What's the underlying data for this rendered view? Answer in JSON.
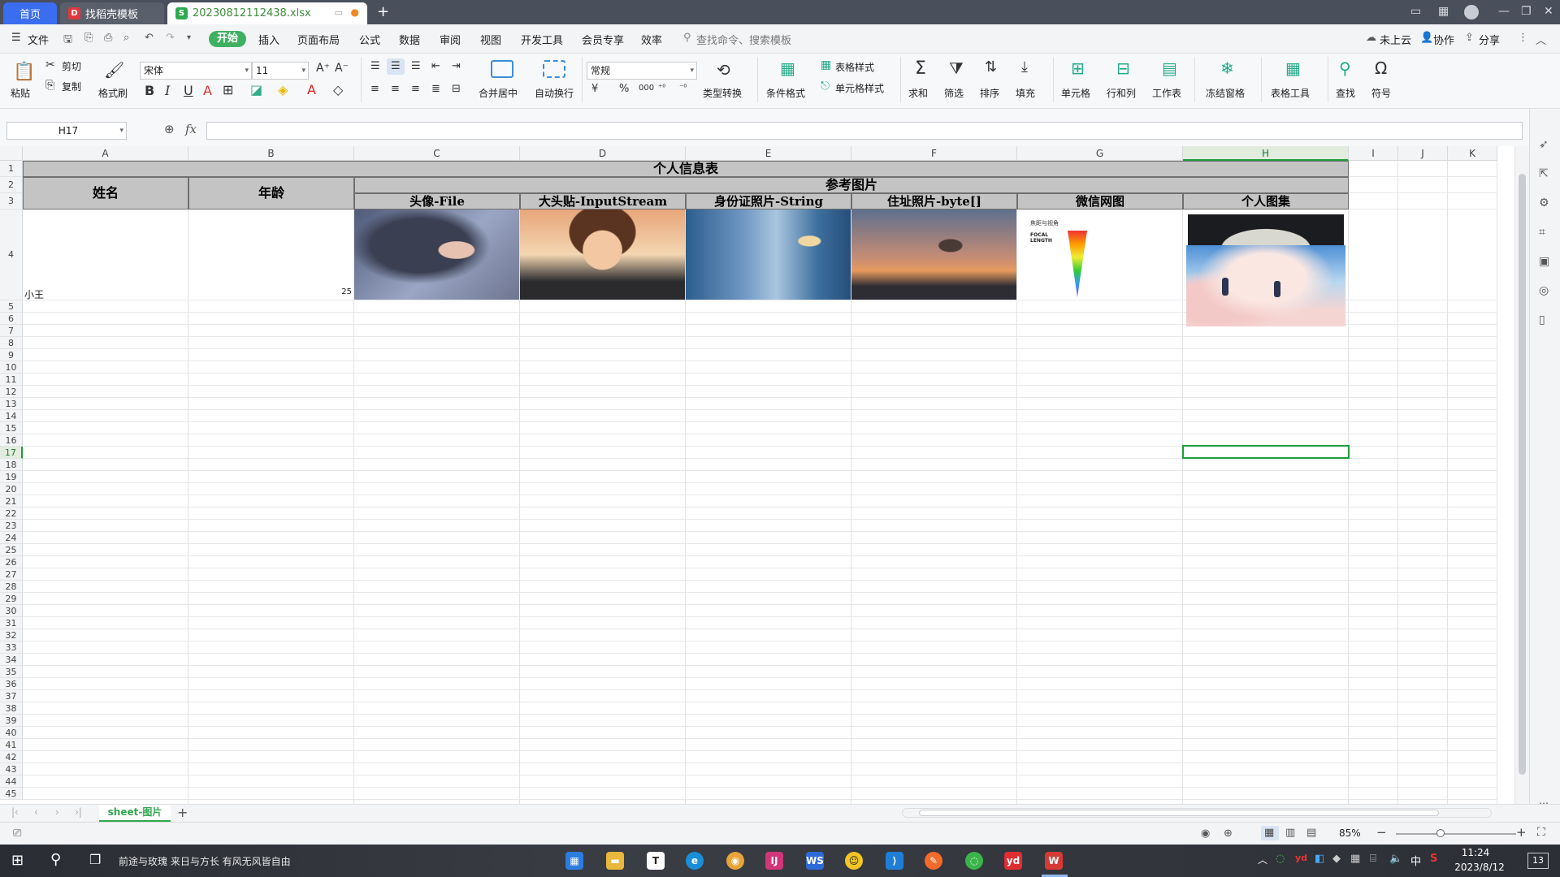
{
  "tabs": {
    "home": "首页",
    "template": "找稻壳模板",
    "file": "20230812112438.xlsx"
  },
  "menu": {
    "file": "文件",
    "items": [
      "开始",
      "插入",
      "页面布局",
      "公式",
      "数据",
      "审阅",
      "视图",
      "开发工具",
      "会员专享",
      "效率"
    ],
    "search_placeholder": "查找命令、搜索模板",
    "cloud": "未上云",
    "collab": "协作",
    "share": "分享"
  },
  "ribbon": {
    "paste": "粘贴",
    "cut": "剪切",
    "copy": "复制",
    "format_painter": "格式刷",
    "font_name": "宋体",
    "font_size": "11",
    "merge_center": "合并居中",
    "wrap": "自动换行",
    "number_format": "常规",
    "type_convert": "类型转换",
    "cond_format": "条件格式",
    "table_style": "表格样式",
    "cell_style": "单元格样式",
    "sum": "求和",
    "filter": "筛选",
    "sort": "排序",
    "fill": "填充",
    "cell": "单元格",
    "row_col": "行和列",
    "worksheet": "工作表",
    "freeze": "冻结窗格",
    "table_tools": "表格工具",
    "find": "查找",
    "symbol": "符号"
  },
  "formula_bar": {
    "name_box": "H17",
    "fx": "fx",
    "value": ""
  },
  "columns": [
    "A",
    "B",
    "C",
    "D",
    "E",
    "F",
    "G",
    "H",
    "I",
    "J",
    "K"
  ],
  "rows": [
    "1",
    "2",
    "3",
    "4",
    "5",
    "6",
    "7",
    "8",
    "9",
    "10",
    "11",
    "12",
    "13",
    "14",
    "15",
    "16",
    "17",
    "18",
    "19",
    "20",
    "21",
    "22",
    "23",
    "24",
    "25",
    "26",
    "27",
    "28",
    "29",
    "30",
    "31",
    "32",
    "33",
    "34",
    "35",
    "36",
    "37",
    "38",
    "39",
    "40",
    "41",
    "42",
    "43",
    "44",
    "45"
  ],
  "sheet": {
    "title": "个人信息表",
    "name_header": "姓名",
    "age_header": "年龄",
    "ref_header": "参考图片",
    "sub_headers": [
      "头像-File",
      "大头贴-InputStream",
      "身份证照片-String",
      "住址照片-byte[]",
      "微信网图",
      "个人图集"
    ],
    "name_value": "小王",
    "age_value": "25",
    "wechat_image_title": "焦距与视角",
    "wechat_image_label": "FOCAL LENGTH"
  },
  "sheet_tabs": [
    "sheet-图片"
  ],
  "status": {
    "zoom": "85%"
  },
  "taskbar": {
    "music": "前途与玫瑰 来日与方长 有风无风皆自由",
    "time": "11:24",
    "date": "2023/8/12",
    "ime": "中",
    "notifications": "13"
  },
  "colors": {
    "accent": "#3fb061",
    "header_fill": "#c4c4c4",
    "selection": "#1f9d3a"
  }
}
